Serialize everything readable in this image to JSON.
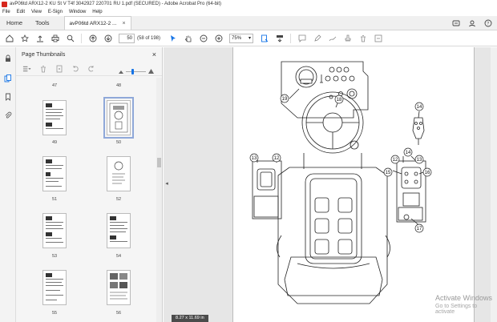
{
  "window": {
    "title": "avP06td ARX12-2 KU St V T4f 3042927 220701 RU 1.pdf (SECURED) - Adobe Acrobat Pro (64-bit)"
  },
  "menu": [
    "File",
    "Edit",
    "View",
    "E-Sign",
    "Window",
    "Help"
  ],
  "tabs": {
    "home": "Home",
    "tools": "Tools",
    "document": "avP06td ARX12-2 ...",
    "close": "×"
  },
  "toolbar": {
    "page_number": "50",
    "page_count": "(58 of 198)",
    "zoom": "75%"
  },
  "panel": {
    "title": "Page Thumbnails",
    "close": "×",
    "thumbnails": [
      {
        "label": "47"
      },
      {
        "label": "48"
      },
      {
        "label": "49"
      },
      {
        "label": "50"
      },
      {
        "label": "51"
      },
      {
        "label": "52"
      },
      {
        "label": "53"
      },
      {
        "label": "54"
      },
      {
        "label": "55"
      },
      {
        "label": "56"
      }
    ]
  },
  "document": {
    "page_size": "8.27 x 11.69 in",
    "callouts": [
      "19",
      "18",
      "14",
      "13",
      "12",
      "12",
      "14",
      "13",
      "15",
      "16",
      "17"
    ]
  },
  "watermark": {
    "line1": "Activate Windows",
    "line2": "Go to Settings to activate"
  },
  "colors": {
    "accent": "#1473e6",
    "acrobat_red": "#d6271d"
  }
}
